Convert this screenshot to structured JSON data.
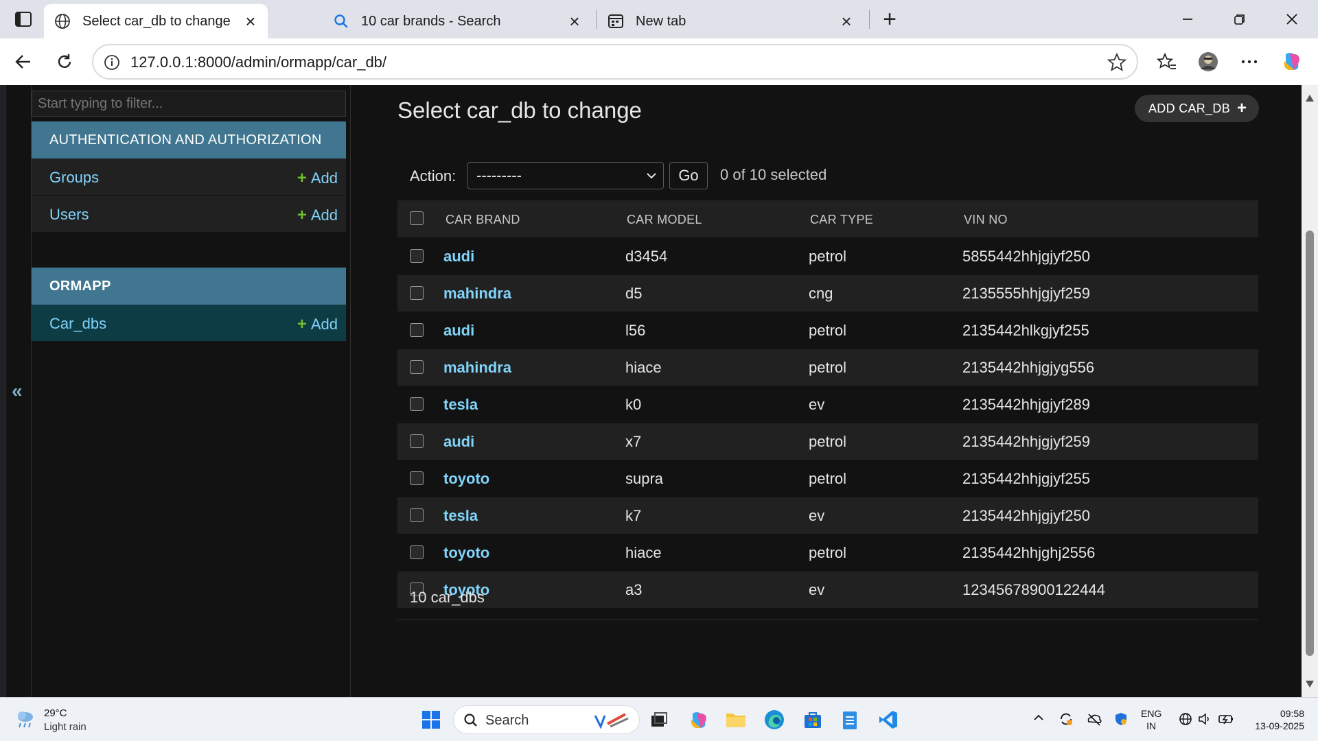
{
  "browser": {
    "tabs": [
      {
        "title": "Select car_db to change | Django",
        "active": true,
        "icon": "globe-icon"
      },
      {
        "title": "10 car brands - Search",
        "active": false,
        "icon": "search-icon"
      },
      {
        "title": "New tab",
        "active": false,
        "icon": "newtab-icon"
      }
    ],
    "url": "127.0.0.1:8000/admin/ormapp/car_db/"
  },
  "sidebar": {
    "filter_placeholder": "Start typing to filter...",
    "modules": [
      {
        "header": "AUTHENTICATION AND AUTHORIZATION",
        "items": [
          {
            "name": "Groups",
            "add_label": "Add"
          },
          {
            "name": "Users",
            "add_label": "Add"
          }
        ]
      },
      {
        "header": "ORMAPP",
        "items": [
          {
            "name": "Car_dbs",
            "add_label": "Add",
            "selected": true
          }
        ]
      }
    ],
    "collapse_glyph": "«"
  },
  "content": {
    "title": "Select car_db to change",
    "add_button": "ADD CAR_DB",
    "action_label": "Action:",
    "action_value": "---------",
    "go_label": "Go",
    "selection_counter": "0 of 10 selected",
    "columns": [
      "CAR BRAND",
      "CAR MODEL",
      "CAR TYPE",
      "VIN NO"
    ],
    "rows": [
      {
        "brand": "audi",
        "model": "d3454",
        "type": "petrol",
        "vin": "5855442hhjgjyf250"
      },
      {
        "brand": "mahindra",
        "model": "d5",
        "type": "cng",
        "vin": "2135555hhjgjyf259"
      },
      {
        "brand": "audi",
        "model": "l56",
        "type": "petrol",
        "vin": "2135442hlkgjyf255"
      },
      {
        "brand": "mahindra",
        "model": "hiace",
        "type": "petrol",
        "vin": "2135442hhjgjyg556"
      },
      {
        "brand": "tesla",
        "model": "k0",
        "type": "ev",
        "vin": "2135442hhjgjyf289"
      },
      {
        "brand": "audi",
        "model": "x7",
        "type": "petrol",
        "vin": "2135442hhjgjyf259"
      },
      {
        "brand": "toyoto",
        "model": "supra",
        "type": "petrol",
        "vin": "2135442hhjgjyf255"
      },
      {
        "brand": "tesla",
        "model": "k7",
        "type": "ev",
        "vin": "2135442hhjgjyf250"
      },
      {
        "brand": "toyoto",
        "model": "hiace",
        "type": "petrol",
        "vin": "2135442hhjghj2556"
      },
      {
        "brand": "toyoto",
        "model": "a3",
        "type": "ev",
        "vin": "12345678900122444"
      }
    ],
    "footer": "10 car_dbs"
  },
  "taskbar": {
    "weather_temp": "29°C",
    "weather_desc": "Light rain",
    "search_label": "Search",
    "lang_top": "ENG",
    "lang_bottom": "IN",
    "time": "09:58",
    "date": "13-09-2025"
  },
  "colors": {
    "module_header": "#417690",
    "link": "#81d4fa",
    "add_plus": "#70bf2b",
    "selected_row": "#0e3c45"
  }
}
